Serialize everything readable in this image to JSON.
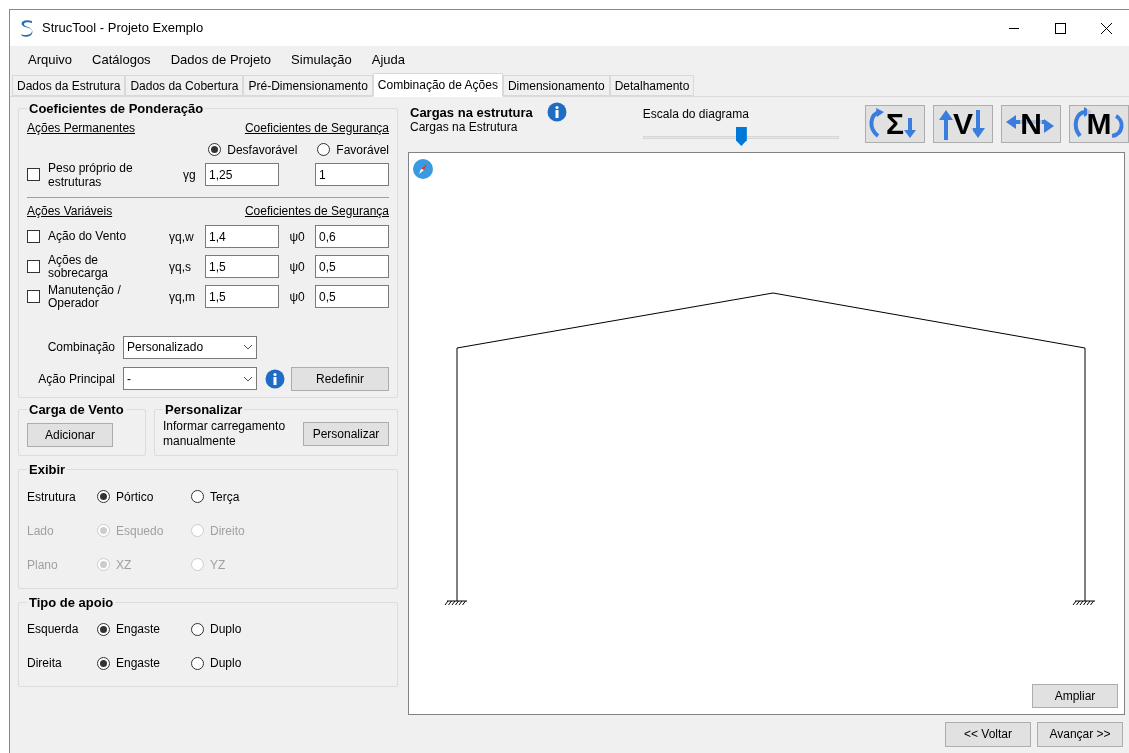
{
  "window": {
    "title": "StrucTool - Projeto Exemplo"
  },
  "menu": [
    "Arquivo",
    "Catálogos",
    "Dados de Projeto",
    "Simulação",
    "Ajuda"
  ],
  "tabs": [
    {
      "label": "Dados da Estrutura",
      "selected": false
    },
    {
      "label": "Dados da Cobertura",
      "selected": false
    },
    {
      "label": "Pré-Dimensionamento",
      "selected": false
    },
    {
      "label": "Combinação de Ações",
      "selected": true
    },
    {
      "label": "Dimensionamento",
      "selected": false
    },
    {
      "label": "Detalhamento",
      "selected": false
    }
  ],
  "coeficientes": {
    "title": "Coeficientes de Ponderação",
    "permanentes": {
      "heading": "Ações Permanentes",
      "coef_heading": "Coeficientes de Segurança",
      "options": [
        {
          "label": "Desfavorável",
          "selected": true
        },
        {
          "label": "Favorável",
          "selected": false
        }
      ],
      "item": {
        "label": "Peso próprio de estruturas",
        "checked": false,
        "symbol": "γg",
        "value": "1,25",
        "value_2": "1"
      }
    },
    "variaveis": {
      "heading": "Ações Variáveis",
      "coef_heading": "Coeficientes de Segurança",
      "items": [
        {
          "label": "Ação do Vento",
          "checked": false,
          "gamma_symbol": "γq,w",
          "gamma": "1,4",
          "psi_symbol": "ψ0",
          "psi": "0,6"
        },
        {
          "label": "Ações de sobrecarga",
          "checked": false,
          "gamma_symbol": "γq,s",
          "gamma": "1,5",
          "psi_symbol": "ψ0",
          "psi": "0,5"
        },
        {
          "label": "Manutenção / Operador",
          "checked": false,
          "gamma_symbol": "γq,m",
          "gamma": "1,5",
          "psi_symbol": "ψ0",
          "psi": "0,5"
        }
      ]
    },
    "combinacao": {
      "label": "Combinação",
      "value": "Personalizado"
    },
    "acao_principal": {
      "label": "Ação Principal",
      "value": "-"
    },
    "redefinir": "Redefinir"
  },
  "carga_vento": {
    "title": "Carga de Vento",
    "button": "Adicionar"
  },
  "personalizar": {
    "title": "Personalizar",
    "text": "Informar carregamento manualmente",
    "button": "Personalizar"
  },
  "exibir": {
    "title": "Exibir",
    "rows": [
      {
        "label": "Estrutura",
        "disabled": false,
        "options": [
          {
            "label": "Pórtico",
            "selected": true
          },
          {
            "label": "Terça",
            "selected": false
          }
        ]
      },
      {
        "label": "Lado",
        "disabled": true,
        "options": [
          {
            "label": "Esquedo",
            "selected": true
          },
          {
            "label": "Direito",
            "selected": false
          }
        ]
      },
      {
        "label": "Plano",
        "disabled": true,
        "options": [
          {
            "label": "XZ",
            "selected": true
          },
          {
            "label": "YZ",
            "selected": false
          }
        ]
      }
    ]
  },
  "tipo_apoio": {
    "title": "Tipo de apoio",
    "rows": [
      {
        "label": "Esquerda",
        "disabled": false,
        "options": [
          {
            "label": "Engaste",
            "selected": true
          },
          {
            "label": "Duplo",
            "selected": false
          }
        ]
      },
      {
        "label": "Direita",
        "disabled": false,
        "options": [
          {
            "label": "Engaste",
            "selected": true
          },
          {
            "label": "Duplo",
            "selected": false
          }
        ]
      }
    ]
  },
  "diagram": {
    "title": "Cargas na estrutura",
    "subtitle": "Cargas na Estrutura",
    "scale_label": "Escala do diagrama",
    "scale": {
      "level": 0.5
    },
    "tools": [
      {
        "kind": "sum",
        "symbol": "Σ"
      },
      {
        "kind": "shear",
        "symbol": "V"
      },
      {
        "kind": "normal",
        "symbol": "N"
      },
      {
        "kind": "moment",
        "symbol": "M"
      }
    ],
    "zoom_button": "Ampliar"
  },
  "nav": [
    "<< Voltar",
    "Avançar >>"
  ]
}
